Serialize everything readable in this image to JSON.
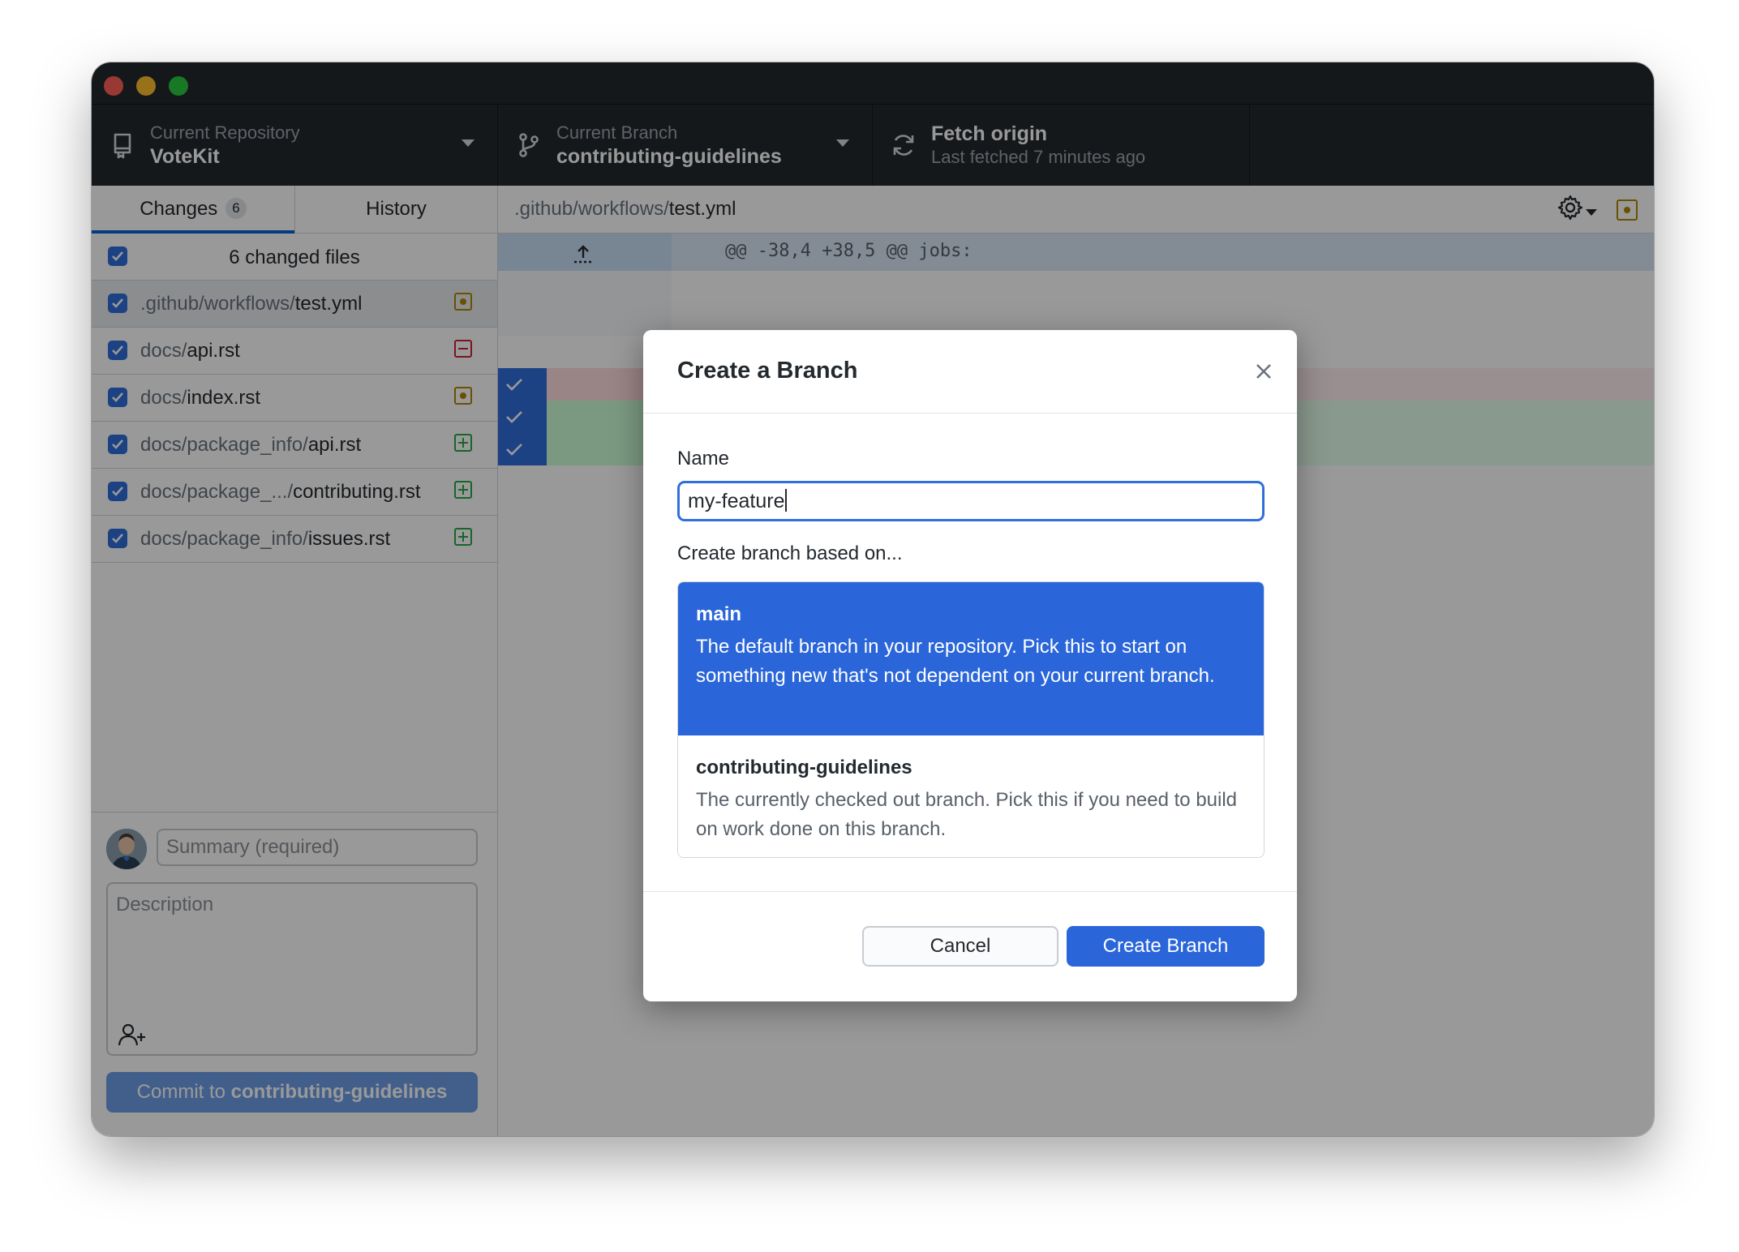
{
  "toolbar": {
    "repository": {
      "sub": "Current Repository",
      "main": "VoteKit"
    },
    "branch": {
      "sub": "Current Branch",
      "main": "contributing-guidelines"
    },
    "fetch": {
      "main": "Fetch origin",
      "sub": "Last fetched 7 minutes ago"
    }
  },
  "sidebar": {
    "tabs": {
      "changes": "Changes",
      "changes_count": "6",
      "history": "History"
    },
    "changed_files_label": "6 changed files",
    "files": [
      {
        "dir": ".github/workflows/",
        "name": "test.yml",
        "status": "modified"
      },
      {
        "dir": "docs/",
        "name": "api.rst",
        "status": "deleted"
      },
      {
        "dir": "docs/",
        "name": "index.rst",
        "status": "modified"
      },
      {
        "dir": "docs/package_info/",
        "name": "api.rst",
        "status": "added"
      },
      {
        "dir": "docs/package_.../",
        "name": "contributing.rst",
        "status": "added"
      },
      {
        "dir": "docs/package_info/",
        "name": "issues.rst",
        "status": "added"
      }
    ],
    "commit": {
      "summary_placeholder": "Summary (required)",
      "description_placeholder": "Description",
      "button_prefix": "Commit to ",
      "button_branch": "contributing-guidelines"
    }
  },
  "diff": {
    "path_dir": ".github/workflows/",
    "path_file": "test.yml",
    "hunk_header": "@@ -38,4 +38,5 @@ jobs:"
  },
  "dialog": {
    "title": "Create a Branch",
    "name_label": "Name",
    "name_value": "my-feature",
    "based_on_label": "Create branch based on...",
    "options": [
      {
        "name": "main",
        "description": "The default branch in your repository. Pick this to start on something new that's not dependent on your current branch.",
        "selected": true
      },
      {
        "name": "contributing-guidelines",
        "description": "The currently checked out branch. Pick this if you need to build on work done on this branch.",
        "selected": false
      }
    ],
    "cancel_label": "Cancel",
    "create_label": "Create Branch"
  }
}
